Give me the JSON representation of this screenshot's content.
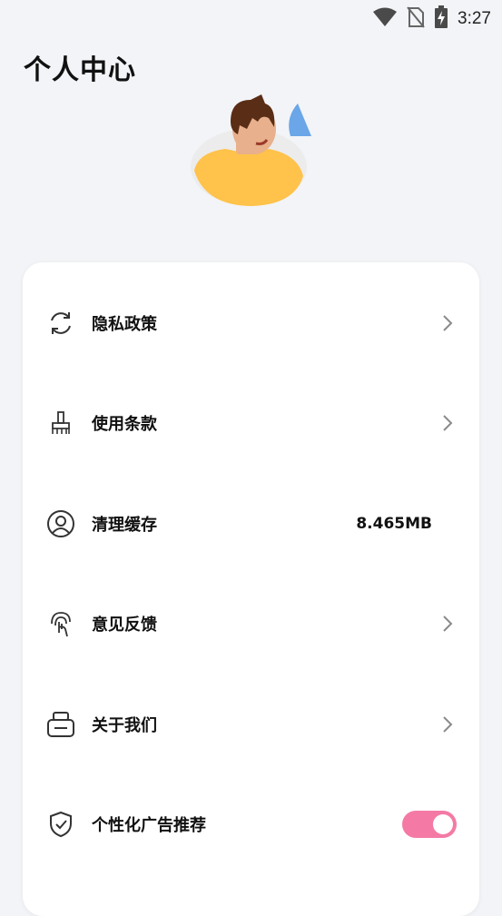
{
  "status_bar": {
    "time": "3:27",
    "icons": [
      "wifi-icon",
      "no-sim-icon",
      "battery-charging-icon"
    ]
  },
  "page": {
    "title": "个人中心"
  },
  "avatar": {
    "icon": "person-avatar-illustration",
    "colors": {
      "shirt": "#ffc24a",
      "skin": "#e8b08c",
      "hair": "#5a2d16",
      "accent": "#6aa6e8",
      "background": "#ececec"
    }
  },
  "menu": {
    "items": [
      {
        "label": "隐私政策",
        "icon": "refresh-icon",
        "type": "link"
      },
      {
        "label": "使用条款",
        "icon": "brush-icon",
        "type": "link"
      },
      {
        "label": "清理缓存",
        "icon": "user-circle-icon",
        "type": "value",
        "value": "8.465MB"
      },
      {
        "label": "意见反馈",
        "icon": "fingerprint-icon",
        "type": "link"
      },
      {
        "label": "关于我们",
        "icon": "printer-icon",
        "type": "link"
      },
      {
        "label": "个性化广告推荐",
        "icon": "shield-check-icon",
        "type": "toggle",
        "enabled": true
      }
    ]
  },
  "colors": {
    "toggle_on": "#f47aa5",
    "background": "#f2f4f7",
    "card": "#ffffff"
  }
}
